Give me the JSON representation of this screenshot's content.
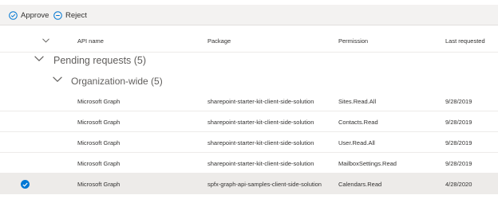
{
  "toolbar": {
    "approve_label": "Approve",
    "reject_label": "Reject"
  },
  "columns": {
    "api_name": "API name",
    "package": "Package",
    "permission": "Permission",
    "last_requested": "Last requested"
  },
  "groups": {
    "pending": "Pending requests (5)",
    "org_wide": "Organization-wide (5)"
  },
  "rows": [
    {
      "api": "Microsoft Graph",
      "package": "sharepoint-starter-kit-client-side-solution",
      "permission": "Sites.Read.All",
      "date": "9/28/2019",
      "selected": false
    },
    {
      "api": "Microsoft Graph",
      "package": "sharepoint-starter-kit-client-side-solution",
      "permission": "Contacts.Read",
      "date": "9/28/2019",
      "selected": false
    },
    {
      "api": "Microsoft Graph",
      "package": "sharepoint-starter-kit-client-side-solution",
      "permission": "User.Read.All",
      "date": "9/28/2019",
      "selected": false
    },
    {
      "api": "Microsoft Graph",
      "package": "sharepoint-starter-kit-client-side-solution",
      "permission": "MailboxSettings.Read",
      "date": "9/28/2019",
      "selected": false
    },
    {
      "api": "Microsoft Graph",
      "package": "spfx-graph-api-samples-client-side-solution",
      "permission": "Calendars.Read",
      "date": "4/28/2020",
      "selected": true
    }
  ],
  "colors": {
    "accent": "#0078d4",
    "command_bar": "#f3f2f1",
    "selected_row": "#edebe9"
  }
}
